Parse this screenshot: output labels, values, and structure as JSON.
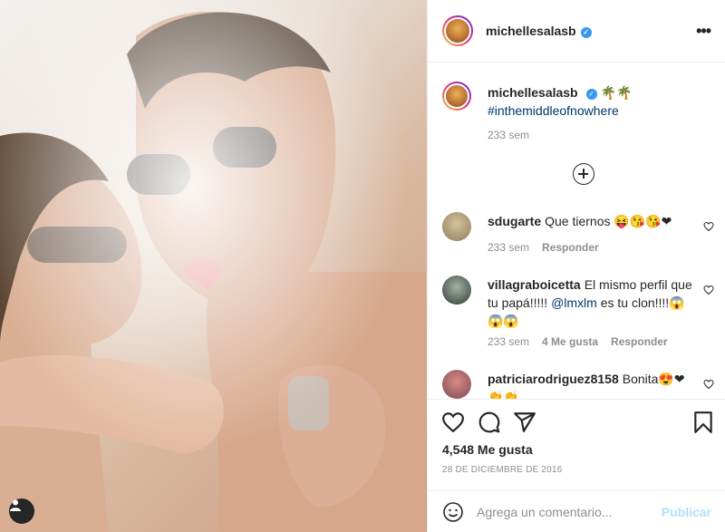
{
  "post": {
    "author": "michellesalasb",
    "verified_icon": "verified-badge-icon",
    "more_icon": "more-options-icon"
  },
  "caption": {
    "username": "michellesalasb",
    "emojis": "🌴🌴",
    "hashtag": "#inthemiddleofnowhere",
    "time": "233 sem"
  },
  "comments": [
    {
      "username": "sdugarte",
      "text": "Que tiernos 😝😘😘❤",
      "time": "233 sem",
      "likes": "",
      "reply": "Responder"
    },
    {
      "username": "villagraboicetta",
      "text": "El mismo perfil que tu papá!!!!! ",
      "mention": "@lmxlm",
      "text_after": " es tu clon!!!!😱😱😱",
      "time": "233 sem",
      "likes": "4 Me gusta",
      "reply": "Responder"
    },
    {
      "username": "patriciarodriguez8158",
      "text": "Bonita😍❤",
      "text_line2": "👏👏",
      "time": "",
      "likes": "",
      "reply": ""
    }
  ],
  "actions": {
    "likes": "4,548 Me gusta",
    "date": "28 de diciembre de 2016"
  },
  "add_comment": {
    "placeholder": "Agrega un comentario...",
    "publish": "Publicar"
  },
  "colors": {
    "link": "#00376b",
    "verified": "#3897f0",
    "muted": "#8e8e8e",
    "publish_disabled": "#b2dffc"
  }
}
